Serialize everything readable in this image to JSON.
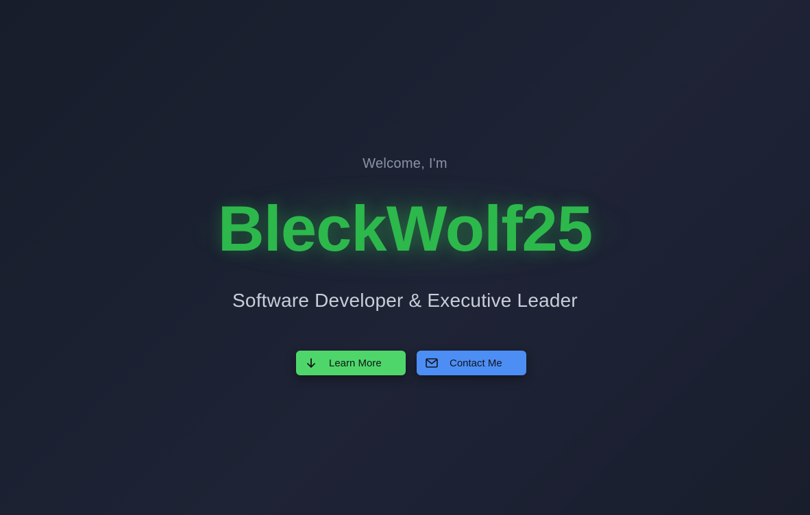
{
  "hero": {
    "greeting": "Welcome, I'm",
    "name": "BleckWolf25",
    "tagline": "Software Developer & Executive Leader"
  },
  "buttons": {
    "learn_more": {
      "label": "Learn More",
      "icon": "arrow-down-icon",
      "color": "#4fd66a"
    },
    "contact_me": {
      "label": "Contact Me",
      "icon": "mail-icon",
      "color": "#4d8ef5"
    }
  },
  "colors": {
    "accent_green": "#2db84c",
    "background": "#1b2131",
    "muted_text": "#8a93a6",
    "tagline_text": "#c8cdd8"
  }
}
